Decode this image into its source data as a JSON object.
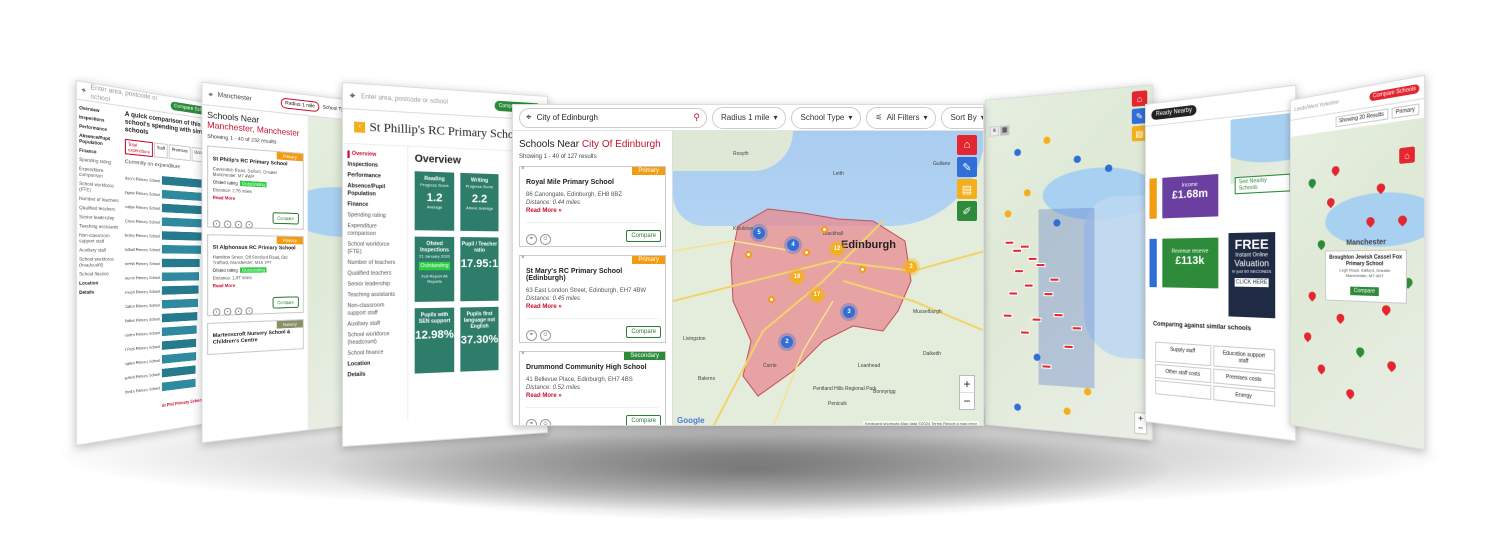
{
  "colors": {
    "accent": "#c8102e",
    "primary_badge": "#f39c12",
    "secondary_badge": "#2e8b3a",
    "teal": "#2e7d6a",
    "red": "#e3262f",
    "blue": "#2f6fd6",
    "yellow": "#f3b01c",
    "purple": "#6a3fa0",
    "green": "#2e8b3a",
    "dark": "#1f2a44"
  },
  "search": {
    "query": "City of Edinburgh",
    "placeholder": "Enter area, postcode or school"
  },
  "filters": {
    "radius": "Radius 1 mile",
    "school_type": "School Type",
    "all_filters": "All Filters",
    "sort_by": "Sort By"
  },
  "results": {
    "title_prefix": "Schools Near ",
    "title_place": "City Of Edinburgh",
    "count": "Showing 1 - 40 of 127 results"
  },
  "cards": [
    {
      "name": "Royal Mile Primary School",
      "address": "86 Canongate, Edinburgh, EH8 8BZ",
      "distance": "Distance: 0.44 miles",
      "badge": "Primary",
      "read_more": "Read More",
      "compare": "Compare"
    },
    {
      "name": "St Mary's RC Primary School (Edinburgh)",
      "address": "63 East London Street, Edinburgh, EH7 4BW",
      "distance": "Distance: 0.45 miles",
      "badge": "Primary",
      "read_more": "Read More",
      "compare": "Compare"
    },
    {
      "name": "Drummond Community High School",
      "address": "41 Bellevue Place, Edinburgh, EH7 4BS",
      "distance": "Distance: 0.52 miles",
      "badge": "Secondary",
      "read_more": "Read More",
      "compare": "Compare"
    }
  ],
  "map": {
    "city_label": "Edinburgh",
    "places": [
      "Musselburgh",
      "Dalkeith",
      "Livingston",
      "Penicuik",
      "Bonnyrigg",
      "Loanhead",
      "Balerno",
      "Currie",
      "Gullane",
      "Leith",
      "Blackhall",
      "Kirkliston",
      "Pentland Hills Regional Park",
      "Rosyth"
    ],
    "zoom_in": "+",
    "zoom_out": "−",
    "attribution": "Keyboard shortcuts  Map data ©2024  Terms  Report a map error",
    "google": "Google"
  },
  "clusters": [
    "5",
    "4",
    "12",
    "17",
    "18",
    "3",
    "2",
    "3"
  ],
  "school_panel": {
    "title": "St Phillip's RC Primary School",
    "search_placeholder": "Enter area, postcode or school",
    "compare_btn": "Compare Schools",
    "heading": "Overview",
    "nav": [
      "Overview",
      "Inspections",
      "Performance",
      "Absence/Pupil Population",
      "Finance",
      "Spending rating",
      "Expenditure comparison",
      "School workforce (FTE)",
      "Number of teachers",
      "Qualified teachers",
      "Senior leadership",
      "Teaching assistants",
      "Non-classroom support staff",
      "Auxiliary staff",
      "School workforce (headcount)",
      "School finance",
      "Location",
      "Details"
    ],
    "tiles": [
      {
        "label": "Reading",
        "sub": "Progress Score",
        "value": "1.2",
        "foot": "Average"
      },
      {
        "label": "Writing",
        "sub": "Progress Score",
        "value": "2.2",
        "foot": "Above average"
      },
      {
        "label": "Ofsted Inspections",
        "sub": "21 January 2020",
        "value": "Outstanding",
        "foot": "Full Report  All Reports"
      },
      {
        "label": "Pupil / Teacher ratio",
        "sub": "",
        "value": "17.95:1",
        "foot": ""
      },
      {
        "label": "Pupils with SEN support",
        "sub": "",
        "value": "12.98%",
        "foot": ""
      },
      {
        "label": "Pupils first language not English",
        "sub": "",
        "value": "37.30%",
        "foot": ""
      }
    ]
  },
  "manchester_panel": {
    "search": "Manchester",
    "radius": "Radius 1 mile",
    "type": "School Type",
    "title_prefix": "Schools Near ",
    "title_place": "Manchester, Manchester",
    "count": "Showing 1 - 40 of 232 results",
    "cards": [
      {
        "name": "St Philip's RC Primary School",
        "address": "Cavendish Road, Salford, Greater Manchester, M7 4WP",
        "rating_label": "Ofsted rating",
        "rating": "Outstanding",
        "distance": "Distance: 2.76 miles",
        "read_more": "Read More",
        "compare": "Compare",
        "badge": "Primary"
      },
      {
        "name": "St Alphonsus RC Primary School",
        "address": "Hamilton Street, Off Stretford Road, Old Trafford, Manchester, M16 7PT",
        "rating_label": "Ofsted rating",
        "rating": "Outstanding",
        "distance": "Distance: 1.07 miles",
        "read_more": "Read More",
        "compare": "Compare",
        "badge": "Primary"
      },
      {
        "name": "Martenscroft Nursery School & Children's Centre",
        "badge": "Nursery"
      }
    ]
  },
  "left_panel": {
    "search": "Enter area, postcode or school",
    "compare": "Compare Schools",
    "nav": [
      "Overview",
      "Inspections",
      "Performance",
      "Absence/Pupil Population",
      "Finance",
      "Spending rating",
      "Expenditure comparison",
      "School workforce (FTE)",
      "Number of teachers",
      "Qualified teachers",
      "Senior leadership",
      "Teaching assistants",
      "Non-classroom support staff",
      "Auxiliary staff",
      "School workforce (headcount)",
      "School finance",
      "Location",
      "Details"
    ],
    "chart_title": "A quick comparison of this school's spending with similar schools",
    "tabs": [
      "Total expenditure",
      "Staff",
      "Premises",
      "Occupation"
    ],
    "bar_caption": "Currently on expenditure",
    "bar_labels": [
      "Saint Mary's Primary School",
      "Highgate Primary School",
      "Ainsdale Primary School",
      "Holy Cross Primary School",
      "Wellesley Primary School",
      "Asthall Primary School",
      "Stonehill Primary School",
      "Bourne Primary School",
      "Gainsborough Primary School",
      "Dalton Primary School",
      "Walker Primary School",
      "Marsden Primary School",
      "Hirst Park Primary School",
      "Longden Primary School",
      "Mayfield Primary School",
      "St Alfred's Primary School"
    ],
    "bar_values": [
      72,
      70,
      68,
      66,
      65,
      63,
      61,
      60,
      59,
      58,
      57,
      56,
      55,
      55,
      54,
      54
    ],
    "footer_label": "St Phil Primary School"
  },
  "finance_panel": {
    "income_label": "Income",
    "income_value": "£1.68m",
    "reserve_label": "Revenue reserve",
    "reserve_value": "£113k",
    "ready_btn": "Ready Nearby",
    "comparing_title": "Comparing against similar schools",
    "table": [
      "Supply staff",
      "Education support staff",
      "Other staff costs",
      "Premises costs",
      "",
      "Energy"
    ],
    "ad": {
      "title": "FREE",
      "line1": "Instant Online",
      "line2": "Valuation",
      "line3": "in just 60 SECONDS",
      "cta": "CLICK HERE"
    },
    "see_nearby": "See Nearby Schools"
  },
  "right_panel": {
    "search": "Leeds/West Yorkshire",
    "btn": "Compare Schools",
    "sort": "Showing 20 Results",
    "type": "Primary",
    "popup": "Broughton Jewish Cassel Fox Primary School",
    "popup_addr": "Legh Road, Salford, Greater Manchester, M7 4RT",
    "popup_btn": "Compare",
    "place": "Manchester"
  }
}
